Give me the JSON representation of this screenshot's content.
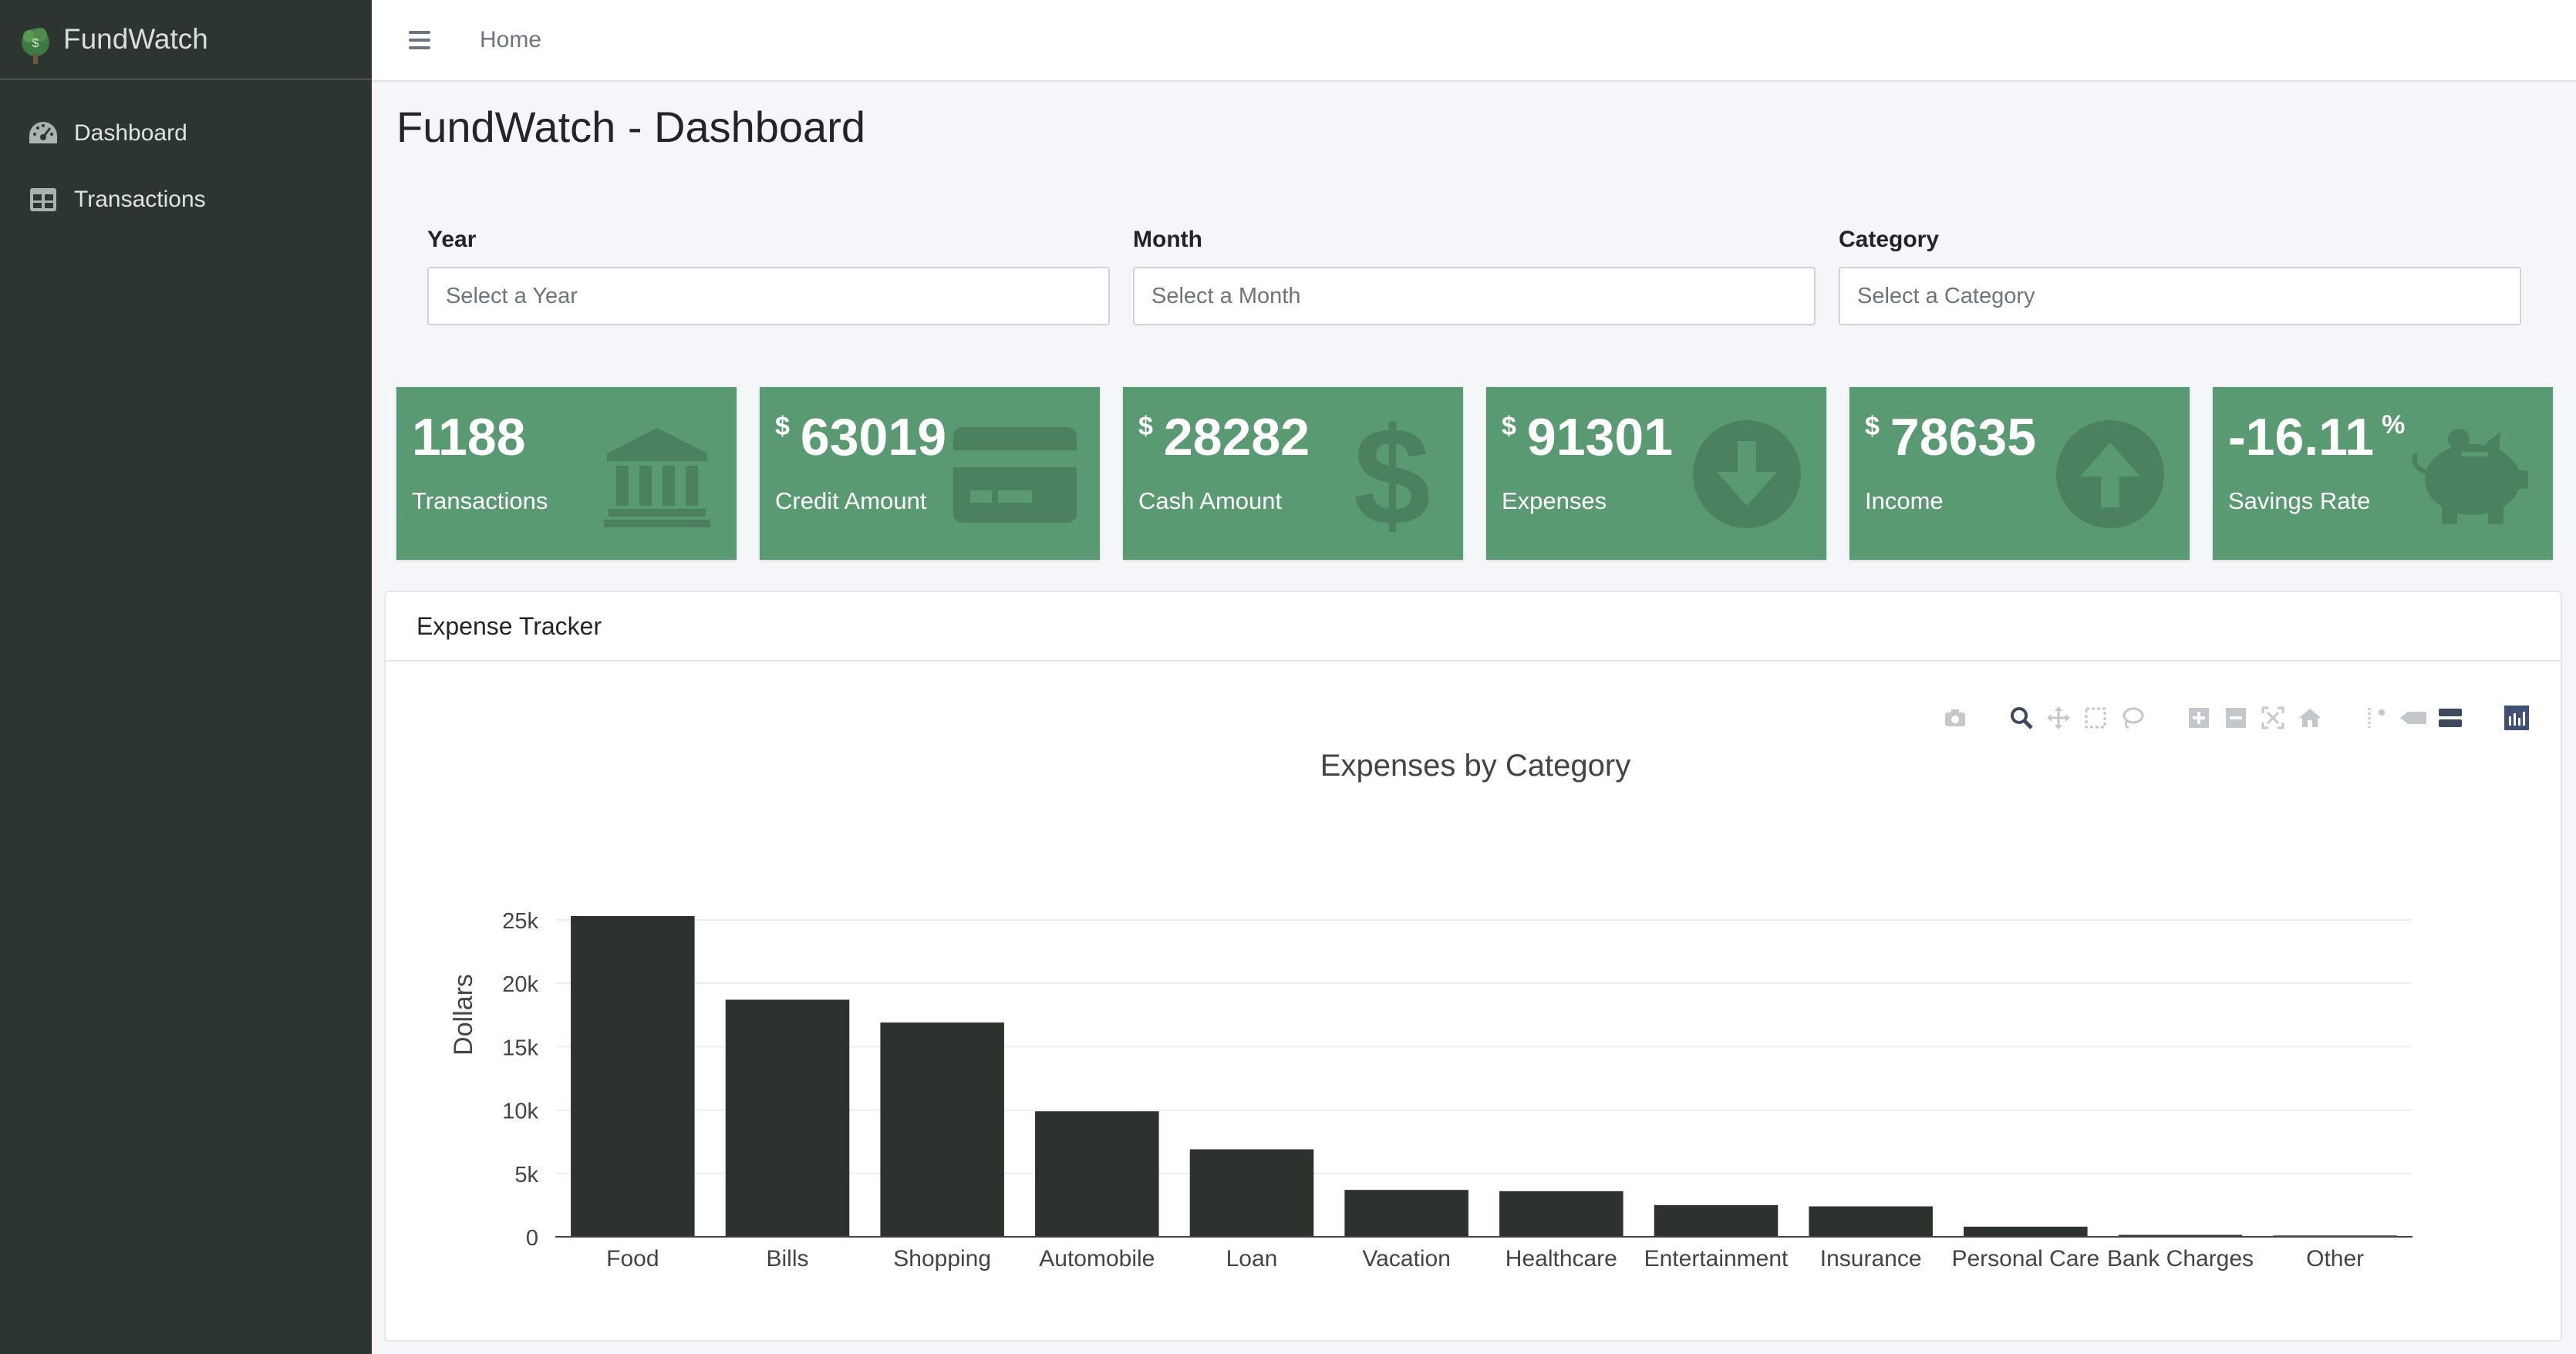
{
  "app": {
    "brand": "FundWatch",
    "page_title": "FundWatch - Dashboard"
  },
  "sidebar": {
    "items": [
      {
        "label": "Dashboard",
        "icon": "tachometer-icon"
      },
      {
        "label": "Transactions",
        "icon": "table-icon"
      }
    ]
  },
  "topbar": {
    "home": "Home"
  },
  "filters": {
    "year": {
      "label": "Year",
      "placeholder": "Select a Year"
    },
    "month": {
      "label": "Month",
      "placeholder": "Select a Month"
    },
    "category": {
      "label": "Category",
      "placeholder": "Select a Category"
    }
  },
  "cards": [
    {
      "value": "1188",
      "prefix": "",
      "suffix": "",
      "label": "Transactions",
      "icon": "bank-icon"
    },
    {
      "value": "63019",
      "prefix": "$",
      "suffix": "",
      "label": "Credit Amount",
      "icon": "credit-card-icon"
    },
    {
      "value": "28282",
      "prefix": "$",
      "suffix": "",
      "label": "Cash Amount",
      "icon": "dollar-icon"
    },
    {
      "value": "91301",
      "prefix": "$",
      "suffix": "",
      "label": "Expenses",
      "icon": "arrow-down-circle-icon"
    },
    {
      "value": "78635",
      "prefix": "$",
      "suffix": "",
      "label": "Income",
      "icon": "arrow-up-circle-icon"
    },
    {
      "value": "-16.11",
      "prefix": "",
      "suffix": "%",
      "label": "Savings Rate",
      "icon": "piggy-bank-icon"
    }
  ],
  "colors": {
    "sidebar_bg": "#2c3530",
    "card_bg": "#5a9a72",
    "bar_color": "#2d322e"
  },
  "panel": {
    "title": "Expense Tracker"
  },
  "chart_data": {
    "type": "bar",
    "title": "Expenses by Category",
    "xlabel": "",
    "ylabel": "Dollars",
    "categories": [
      "Food",
      "Bills",
      "Shopping",
      "Automobile",
      "Loan",
      "Vacation",
      "Healthcare",
      "Entertainment",
      "Insurance",
      "Personal Care",
      "Bank Charges",
      "Other"
    ],
    "values": [
      25300,
      18700,
      16900,
      9900,
      6900,
      3700,
      3600,
      2500,
      2400,
      800,
      150,
      100
    ],
    "ylim": [
      0,
      25300
    ],
    "yticks": [
      0,
      5000,
      10000,
      15000,
      20000,
      25000
    ],
    "ytick_labels": [
      "0",
      "5k",
      "10k",
      "15k",
      "20k",
      "25k"
    ],
    "grid": true,
    "legend": "none"
  }
}
